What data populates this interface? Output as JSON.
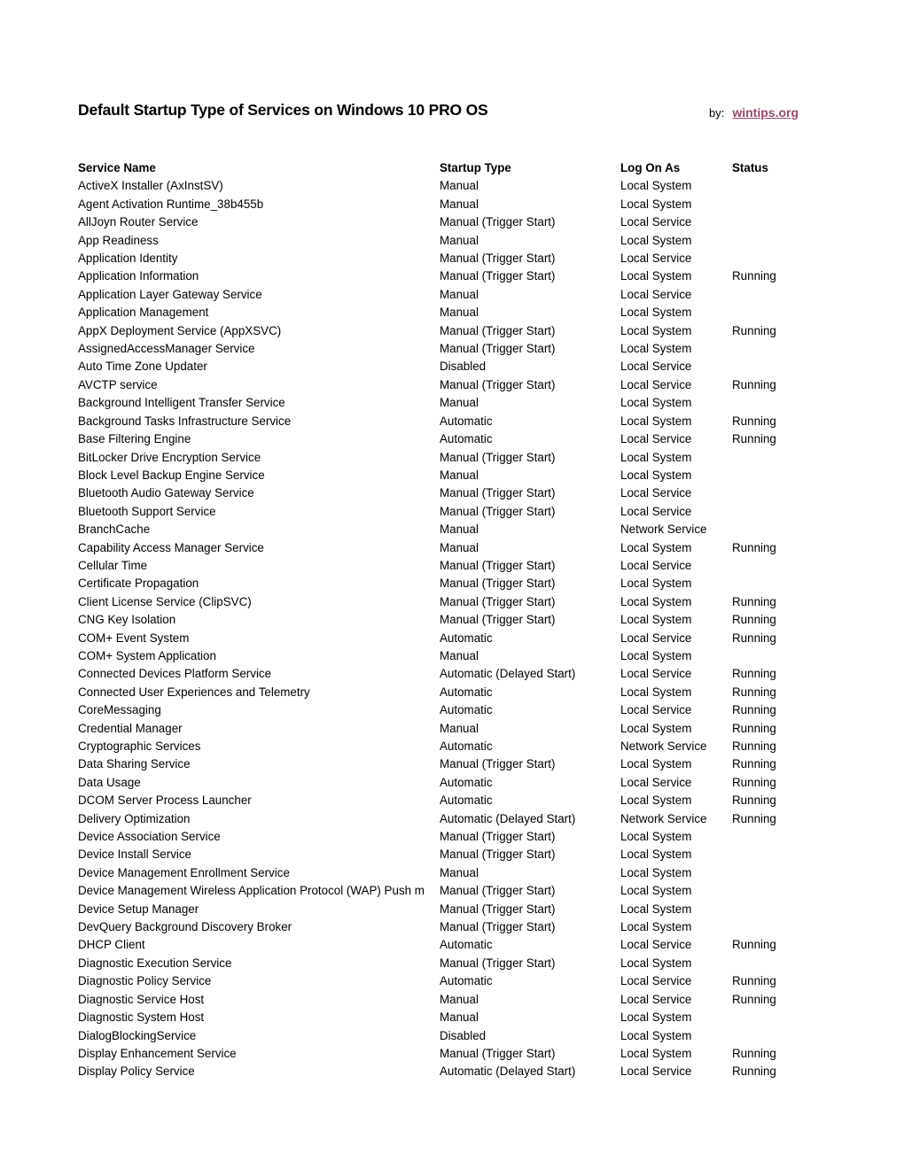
{
  "header": {
    "title": "Default Startup Type of Services on Windows 10 PRO OS",
    "by_label": "by:",
    "site_link": "wintips.org",
    "link_color": "#96466f"
  },
  "table": {
    "columns": [
      "Service Name",
      "Startup Type",
      "Log On As",
      "Status"
    ],
    "rows": [
      [
        "ActiveX Installer (AxInstSV)",
        "Manual",
        "Local System",
        ""
      ],
      [
        "Agent Activation Runtime_38b455b",
        "Manual",
        "Local System",
        ""
      ],
      [
        "AllJoyn Router Service",
        "Manual (Trigger Start)",
        "Local Service",
        ""
      ],
      [
        "App Readiness",
        "Manual",
        "Local System",
        ""
      ],
      [
        "Application Identity",
        "Manual (Trigger Start)",
        "Local Service",
        ""
      ],
      [
        "Application Information",
        "Manual (Trigger Start)",
        "Local System",
        "Running"
      ],
      [
        "Application Layer Gateway Service",
        "Manual",
        "Local Service",
        ""
      ],
      [
        "Application Management",
        "Manual",
        "Local System",
        ""
      ],
      [
        "AppX Deployment Service (AppXSVC)",
        "Manual (Trigger Start)",
        "Local System",
        "Running"
      ],
      [
        "AssignedAccessManager Service",
        "Manual (Trigger Start)",
        "Local System",
        ""
      ],
      [
        "Auto Time Zone Updater",
        "Disabled",
        "Local Service",
        ""
      ],
      [
        "AVCTP service",
        "Manual (Trigger Start)",
        "Local Service",
        "Running"
      ],
      [
        "Background Intelligent Transfer Service",
        "Manual",
        "Local System",
        ""
      ],
      [
        "Background Tasks Infrastructure Service",
        "Automatic",
        "Local System",
        "Running"
      ],
      [
        "Base Filtering Engine",
        "Automatic",
        "Local Service",
        "Running"
      ],
      [
        "BitLocker Drive Encryption Service",
        "Manual (Trigger Start)",
        "Local System",
        ""
      ],
      [
        "Block Level Backup Engine Service",
        "Manual",
        "Local System",
        ""
      ],
      [
        "Bluetooth Audio Gateway Service",
        "Manual (Trigger Start)",
        "Local Service",
        ""
      ],
      [
        "Bluetooth Support Service",
        "Manual (Trigger Start)",
        "Local Service",
        ""
      ],
      [
        "BranchCache",
        "Manual",
        "Network Service",
        ""
      ],
      [
        "Capability Access Manager Service",
        "Manual",
        "Local System",
        "Running"
      ],
      [
        "Cellular Time",
        "Manual (Trigger Start)",
        "Local Service",
        ""
      ],
      [
        "Certificate Propagation",
        "Manual (Trigger Start)",
        "Local System",
        ""
      ],
      [
        "Client License Service (ClipSVC)",
        "Manual (Trigger Start)",
        "Local System",
        "Running"
      ],
      [
        "CNG Key Isolation",
        "Manual (Trigger Start)",
        "Local System",
        "Running"
      ],
      [
        "COM+ Event System",
        "Automatic",
        "Local Service",
        "Running"
      ],
      [
        "COM+ System Application",
        "Manual",
        "Local System",
        ""
      ],
      [
        "Connected Devices Platform Service",
        "Automatic (Delayed Start)",
        "Local Service",
        "Running"
      ],
      [
        "Connected User Experiences and Telemetry",
        "Automatic",
        "Local System",
        "Running"
      ],
      [
        "CoreMessaging",
        "Automatic",
        "Local Service",
        "Running"
      ],
      [
        "Credential Manager",
        "Manual",
        "Local System",
        "Running"
      ],
      [
        "Cryptographic Services",
        "Automatic",
        "Network Service",
        "Running"
      ],
      [
        "Data Sharing Service",
        "Manual (Trigger Start)",
        "Local System",
        "Running"
      ],
      [
        "Data Usage",
        "Automatic",
        "Local Service",
        "Running"
      ],
      [
        "DCOM Server Process Launcher",
        "Automatic",
        "Local System",
        "Running"
      ],
      [
        "Delivery Optimization",
        "Automatic (Delayed Start)",
        "Network Service",
        "Running"
      ],
      [
        "Device Association Service",
        "Manual (Trigger Start)",
        "Local System",
        ""
      ],
      [
        "Device Install Service",
        "Manual (Trigger Start)",
        "Local System",
        ""
      ],
      [
        "Device Management Enrollment Service",
        "Manual",
        "Local System",
        ""
      ],
      [
        "Device Management Wireless Application Protocol (WAP) Push m",
        "Manual (Trigger Start)",
        "Local System",
        ""
      ],
      [
        "Device Setup Manager",
        "Manual (Trigger Start)",
        "Local System",
        ""
      ],
      [
        "DevQuery Background Discovery Broker",
        "Manual (Trigger Start)",
        "Local System",
        ""
      ],
      [
        "DHCP Client",
        "Automatic",
        "Local Service",
        "Running"
      ],
      [
        "Diagnostic Execution Service",
        "Manual (Trigger Start)",
        "Local System",
        ""
      ],
      [
        "Diagnostic Policy Service",
        "Automatic",
        "Local Service",
        "Running"
      ],
      [
        "Diagnostic Service Host",
        "Manual",
        "Local Service",
        "Running"
      ],
      [
        "Diagnostic System Host",
        "Manual",
        "Local System",
        ""
      ],
      [
        "DialogBlockingService",
        "Disabled",
        "Local System",
        ""
      ],
      [
        "Display Enhancement Service",
        "Manual (Trigger Start)",
        "Local System",
        "Running"
      ],
      [
        "Display Policy Service",
        "Automatic (Delayed Start)",
        "Local Service",
        "Running"
      ]
    ]
  }
}
